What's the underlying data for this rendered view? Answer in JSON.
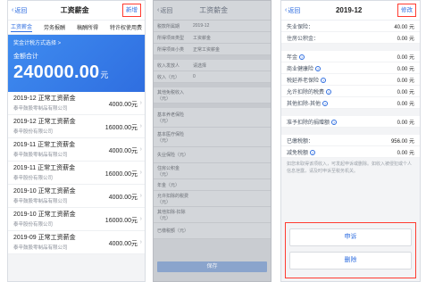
{
  "panel1": {
    "nav": {
      "back": "返回",
      "title": "工资薪金",
      "right": "新增"
    },
    "tabs": [
      "工资薪金",
      "劳务报酬",
      "稿酬所得",
      "特许权使用费"
    ],
    "banner": {
      "choice": "奖金计税方式选择 >",
      "label": "金额合计",
      "amount": "240000.00",
      "unit": "元"
    },
    "rows": [
      {
        "title": "2019-12 正常工资薪金",
        "sub": "泰辛鼓股零制品有限公司",
        "value": "4000.00元"
      },
      {
        "title": "2019-12 正常工资薪金",
        "sub": "泰辛股份有限公司",
        "value": "16000.00元"
      },
      {
        "title": "2019-11 正常工资薪金",
        "sub": "泰辛鼓股零制品有限公司",
        "value": "4000.00元"
      },
      {
        "title": "2019-11 正常工资薪金",
        "sub": "泰辛股份有限公司",
        "value": "16000.00元"
      },
      {
        "title": "2019-10 正常工资薪金",
        "sub": "泰辛鼓股零制品有限公司",
        "value": "4000.00元"
      },
      {
        "title": "2019-10 正常工资薪金",
        "sub": "泰辛股份有限公司",
        "value": "16000.00元"
      },
      {
        "title": "2019-09 正常工资薪金",
        "sub": "泰辛鼓股零制品有限公司",
        "value": "4000.00元"
      }
    ]
  },
  "panel2": {
    "nav": {
      "back": "返回",
      "title": "工资薪金"
    },
    "fields": [
      {
        "k": "税款所属期",
        "v": "2019-12"
      },
      {
        "k": "所得项目类型",
        "v": "工资薪金"
      },
      {
        "k": "所得项目小类",
        "v": "正常工资薪金"
      },
      {
        "k": "收入发放人",
        "v": "请选择"
      },
      {
        "k": "收入（元）",
        "v": "0"
      },
      {
        "k": "其他免税收入（元）",
        "v": ""
      },
      {
        "k": "基本养老保险（元）",
        "v": ""
      },
      {
        "k": "基本医疗保险（元）",
        "v": ""
      },
      {
        "k": "失业保险（元）",
        "v": ""
      },
      {
        "k": "住房公积金（元）",
        "v": ""
      },
      {
        "k": "年金（元）",
        "v": ""
      },
      {
        "k": "允许扣除的税费（元）",
        "v": ""
      },
      {
        "k": "其他扣除-扣除（元）",
        "v": ""
      },
      {
        "k": "已缴税额（元）",
        "v": ""
      }
    ],
    "save": "保存"
  },
  "panel3": {
    "nav": {
      "back": "返回",
      "title": "2019-12",
      "right": "修改"
    },
    "top_rows": [
      {
        "k": "失业保险：",
        "v": "40.00 元"
      },
      {
        "k": "住房公积金：",
        "v": "0.00 元"
      }
    ],
    "mid_rows": [
      {
        "k": "年金",
        "v": "0.00 元"
      },
      {
        "k": "商业健康险",
        "v": "0.00 元"
      },
      {
        "k": "税延养老保险",
        "v": "0.00 元"
      },
      {
        "k": "允许扣除的税费",
        "v": "0.00 元"
      },
      {
        "k": "其他扣除-其他",
        "v": "0.00 元"
      }
    ],
    "donation": {
      "k": "准予扣除的捐赠额",
      "v": "0.00 元"
    },
    "paid": {
      "k": "已缴税额：",
      "v": "956.00 元"
    },
    "reduce": {
      "k": "减免税额",
      "v": "0.00 元"
    },
    "note": "如您未取得该项收入，可发起申诉或删除。如收入被侵犯或个人信息泄露，请及时申诉至税务机关。",
    "buttons": {
      "appeal": "申诉",
      "delete": "删除"
    }
  }
}
